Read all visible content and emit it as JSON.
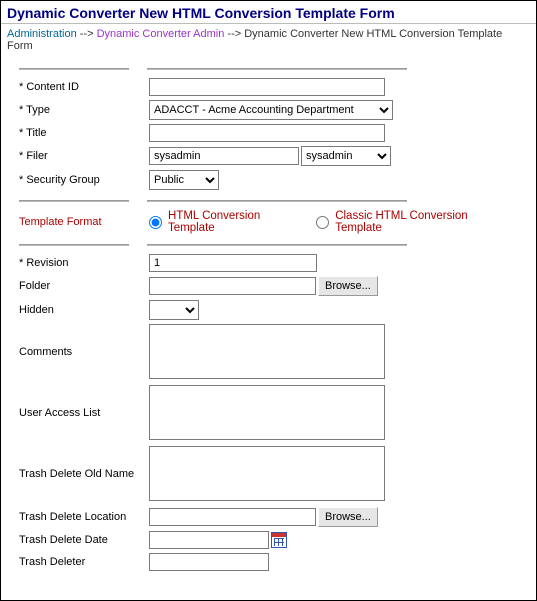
{
  "page": {
    "title": "Dynamic Converter New HTML Conversion Template Form"
  },
  "breadcrumb": {
    "admin": "Administration",
    "sep": " --> ",
    "adminLink": "Dynamic Converter Admin",
    "current": "Dynamic Converter New HTML Conversion Template Form"
  },
  "labels": {
    "contentId": "* Content ID",
    "type": "* Type",
    "title": "* Title",
    "filer": "* Filer",
    "securityGroup": "* Security Group",
    "templateFormat": "Template Format",
    "revision": "* Revision",
    "folder": "Folder",
    "hidden": "Hidden",
    "comments": "Comments",
    "userAccessList": "User Access List",
    "trashDeleteOldName": "Trash Delete Old Name",
    "trashDeleteLocation": "Trash Delete Location",
    "trashDeleteDate": "Trash Delete Date",
    "trashDeleter": "Trash Deleter"
  },
  "fields": {
    "contentId": "",
    "typeSelected": "ADACCT - Acme Accounting Department",
    "title": "",
    "filerText": "sysadmin",
    "filerSelected": "sysadmin",
    "securityGroupSelected": "Public",
    "revision": "1",
    "folder": "",
    "hiddenSelected": "",
    "comments": "",
    "userAccessList": "",
    "trashDeleteOldName": "",
    "trashDeleteLocation": "",
    "trashDeleteDate": "",
    "trashDeleter": ""
  },
  "radios": {
    "htmlConv": "HTML Conversion Template",
    "classicConv": "Classic HTML Conversion Template"
  },
  "buttons": {
    "browse": "Browse..."
  }
}
